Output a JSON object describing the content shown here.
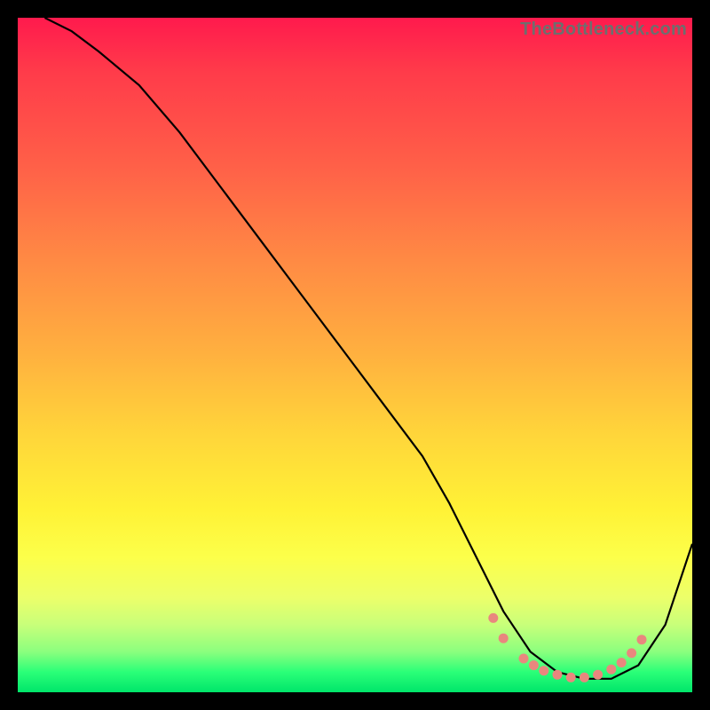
{
  "watermark": "TheBottleneck.com",
  "chart_data": {
    "type": "line",
    "title": "",
    "xlabel": "",
    "ylabel": "",
    "xlim": [
      0,
      100
    ],
    "ylim": [
      0,
      100
    ],
    "grid": false,
    "legend": false,
    "series": [
      {
        "name": "bottleneck-curve",
        "color": "#000000",
        "x": [
          4,
          8,
          12,
          18,
          24,
          30,
          36,
          42,
          48,
          54,
          60,
          64,
          68,
          72,
          76,
          80,
          84,
          88,
          92,
          96,
          100
        ],
        "y": [
          100,
          98,
          95,
          90,
          83,
          75,
          67,
          59,
          51,
          43,
          35,
          28,
          20,
          12,
          6,
          3,
          2,
          2,
          4,
          10,
          22
        ]
      }
    ],
    "markers": {
      "name": "optimal-range",
      "color": "#e9877e",
      "x": [
        70.5,
        72,
        75,
        76.5,
        78,
        80,
        82,
        84,
        86,
        88,
        89.5,
        91,
        92.5
      ],
      "y": [
        11,
        8,
        5,
        4,
        3.2,
        2.6,
        2.2,
        2.2,
        2.6,
        3.4,
        4.4,
        5.8,
        7.8
      ]
    }
  }
}
